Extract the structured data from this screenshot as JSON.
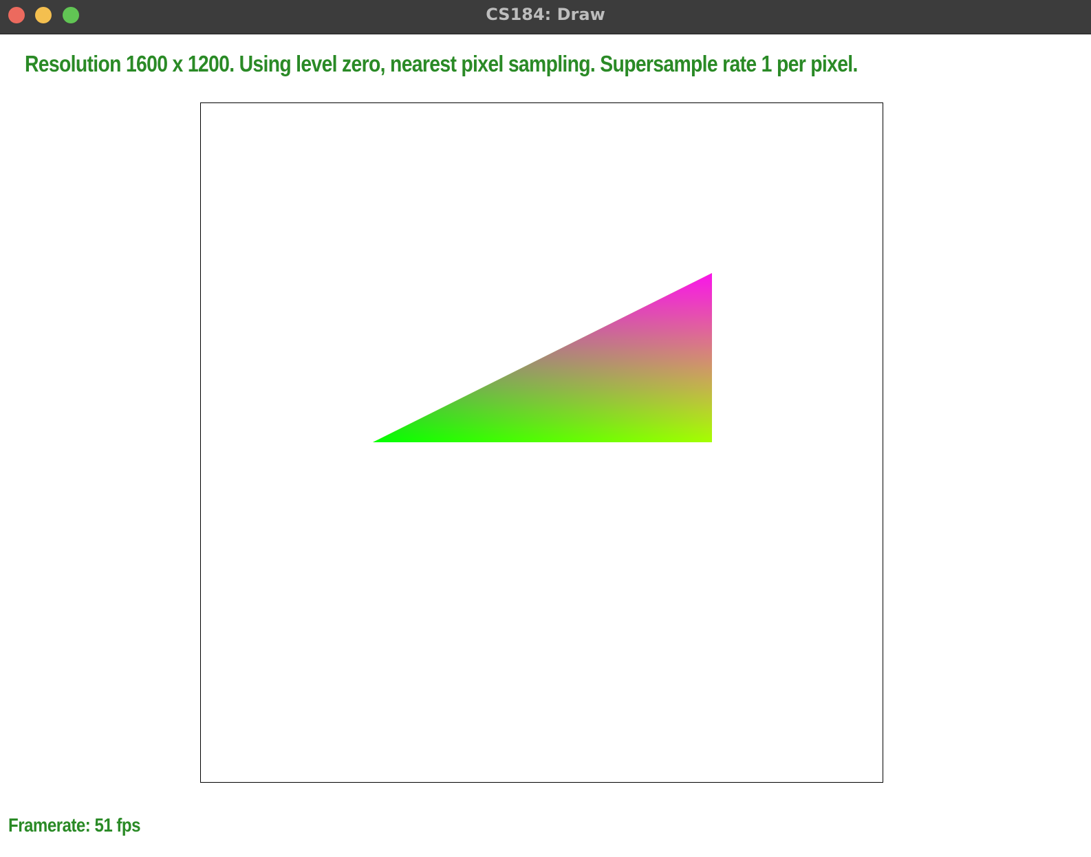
{
  "window": {
    "title": "CS184: Draw"
  },
  "status": {
    "text": "Resolution 1600 x 1200. Using level zero, nearest pixel sampling. Supersample rate 1 per pixel."
  },
  "footer": {
    "framerate": "Framerate: 51 fps"
  },
  "colors": {
    "status_text": "#2a8a26",
    "vertex_green": "#00ff00",
    "vertex_magenta": "#ff00ff",
    "vertex_yellow": "#b0ff00"
  }
}
